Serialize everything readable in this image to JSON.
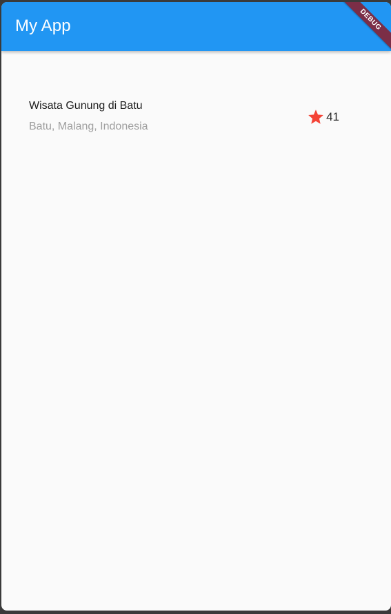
{
  "app": {
    "title": "My App",
    "debug_banner": "DEBUG"
  },
  "place": {
    "name": "Wisata Gunung di Batu",
    "location": "Batu, Malang, Indonesia",
    "rating_count": "41"
  },
  "colors": {
    "appbar": "#2196f3",
    "star": "#f44336",
    "background": "#fafafa"
  },
  "icons": {
    "rating": "star-icon"
  }
}
